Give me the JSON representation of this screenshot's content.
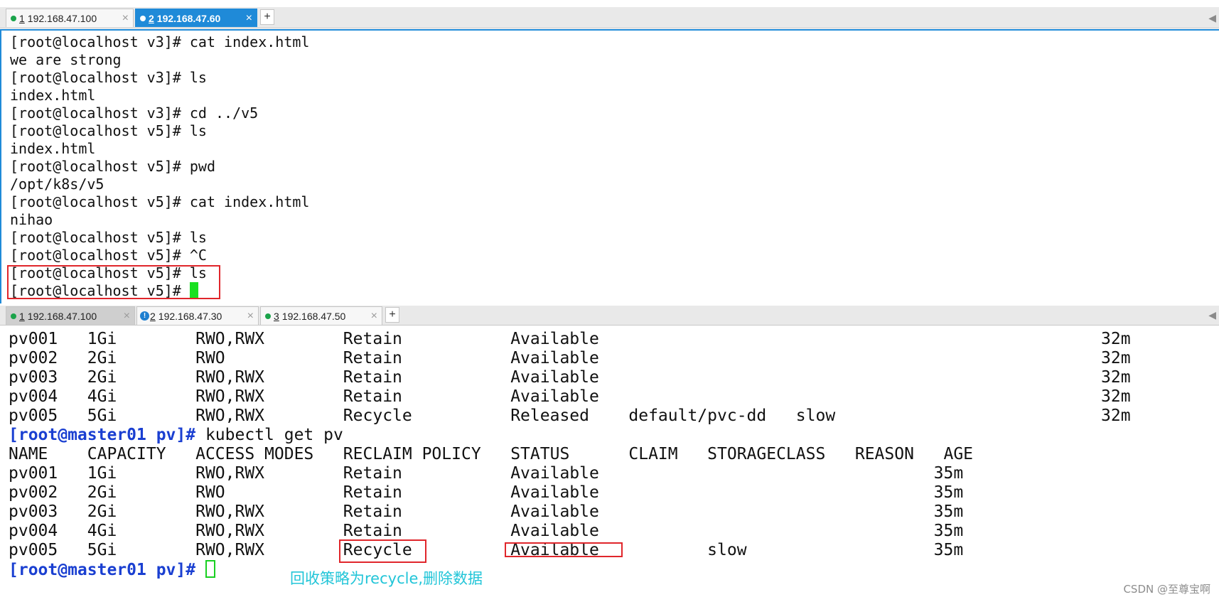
{
  "top_tabs": [
    {
      "num": "1",
      "label": "192.168.47.100",
      "close": "×",
      "active": false
    },
    {
      "num": "2",
      "label": "192.168.47.60",
      "close": "×",
      "active": true
    }
  ],
  "bottom_tabs": [
    {
      "num": "1",
      "label": "192.168.47.100",
      "close": "×",
      "active": true
    },
    {
      "num": "2",
      "label": "192.168.47.30",
      "close": "×",
      "warning": true
    },
    {
      "num": "3",
      "label": "192.168.47.50",
      "close": "×"
    }
  ],
  "new_tab_label": "+",
  "scroll_arrow": "◀",
  "warning_glyph": "!",
  "top_terminal_lines": [
    "[root@localhost v3]# cat index.html",
    "we are strong",
    "[root@localhost v3]# ls",
    "index.html",
    "[root@localhost v3]# cd ../v5",
    "[root@localhost v5]# ls",
    "index.html",
    "[root@localhost v5]# pwd",
    "/opt/k8s/v5",
    "[root@localhost v5]# cat index.html",
    "nihao",
    "[root@localhost v5]# ls",
    "[root@localhost v5]# ^C",
    "[root@localhost v5]# ls",
    "[root@localhost v5]# "
  ],
  "bottom_terminal": {
    "lines_before": [
      "pv001   1Gi        RWO,RWX        Retain           Available                                                   32m",
      "pv002   2Gi        RWO            Retain           Available                                                   32m",
      "pv003   2Gi        RWO,RWX        Retain           Available                                                   32m",
      "pv004   4Gi        RWO,RWX        Retain           Available                                                   32m",
      "pv005   5Gi        RWO,RWX        Recycle          Released    default/pvc-dd   slow                           32m"
    ],
    "prompt": "[root@master01 pv]#",
    "command": " kubectl get pv",
    "lines_after": [
      "NAME    CAPACITY   ACCESS MODES   RECLAIM POLICY   STATUS      CLAIM   STORAGECLASS   REASON   AGE",
      "pv001   1Gi        RWO,RWX        Retain           Available                                  35m",
      "pv002   2Gi        RWO            Retain           Available                                  35m",
      "pv003   2Gi        RWO,RWX        Retain           Available                                  35m",
      "pv004   4Gi        RWO,RWX        Retain           Available                                  35m",
      "pv005   5Gi        RWO,RWX        Recycle          Available           slow                   35m"
    ],
    "final_prompt": "[root@master01 pv]#"
  },
  "annotation": "回收策略为recycle,删除数据",
  "watermark": "CSDN @至尊宝啊",
  "colors": {
    "active_tab": "#1f8ad8",
    "prompt_blue": "#1a3fd1",
    "cursor_green": "#19e021",
    "highlight_red": "#e0262b",
    "annotation_cyan": "#22c5d8"
  }
}
